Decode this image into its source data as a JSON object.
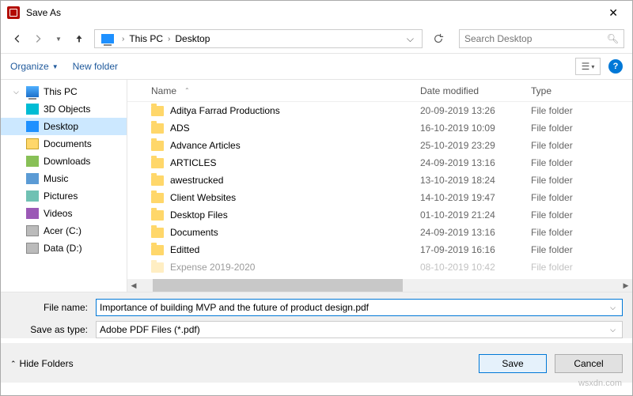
{
  "title": "Save As",
  "breadcrumb": {
    "root": "This PC",
    "current": "Desktop"
  },
  "search": {
    "placeholder": "Search Desktop"
  },
  "toolbar": {
    "organize": "Organize",
    "new_folder": "New folder"
  },
  "tree": {
    "items": [
      {
        "label": "This PC",
        "icon": "pc",
        "sub": false
      },
      {
        "label": "3D Objects",
        "icon": "3d",
        "sub": true
      },
      {
        "label": "Desktop",
        "icon": "desktop",
        "sub": true,
        "selected": true
      },
      {
        "label": "Documents",
        "icon": "docs",
        "sub": true
      },
      {
        "label": "Downloads",
        "icon": "down",
        "sub": true
      },
      {
        "label": "Music",
        "icon": "music",
        "sub": true
      },
      {
        "label": "Pictures",
        "icon": "pics",
        "sub": true
      },
      {
        "label": "Videos",
        "icon": "video",
        "sub": true
      },
      {
        "label": "Acer (C:)",
        "icon": "drive",
        "sub": true
      },
      {
        "label": "Data (D:)",
        "icon": "drive",
        "sub": true
      }
    ]
  },
  "columns": {
    "name": "Name",
    "date": "Date modified",
    "type": "Type"
  },
  "files": [
    {
      "name": "Aditya Farrad Productions",
      "date": "20-09-2019 13:26",
      "type": "File folder"
    },
    {
      "name": "ADS",
      "date": "16-10-2019 10:09",
      "type": "File folder"
    },
    {
      "name": "Advance Articles",
      "date": "25-10-2019 23:29",
      "type": "File folder"
    },
    {
      "name": "ARTICLES",
      "date": "24-09-2019 13:16",
      "type": "File folder"
    },
    {
      "name": "awestrucked",
      "date": "13-10-2019 18:24",
      "type": "File folder"
    },
    {
      "name": "Client Websites",
      "date": "14-10-2019 19:47",
      "type": "File folder"
    },
    {
      "name": "Desktop Files",
      "date": "01-10-2019 21:24",
      "type": "File folder"
    },
    {
      "name": "Documents",
      "date": "24-09-2019 13:16",
      "type": "File folder"
    },
    {
      "name": "Editted",
      "date": "17-09-2019 16:16",
      "type": "File folder"
    },
    {
      "name": "Expense 2019-2020",
      "date": "08-10-2019 10:42",
      "type": "File folder",
      "cut": true
    }
  ],
  "form": {
    "filename_label": "File name:",
    "filename_value": "Importance of building MVP and the future of product design.pdf",
    "savetype_label": "Save as type:",
    "savetype_value": "Adobe PDF Files (*.pdf)"
  },
  "footer": {
    "hide_folders": "Hide Folders",
    "save": "Save",
    "cancel": "Cancel"
  },
  "watermark": "wsxdn.com"
}
